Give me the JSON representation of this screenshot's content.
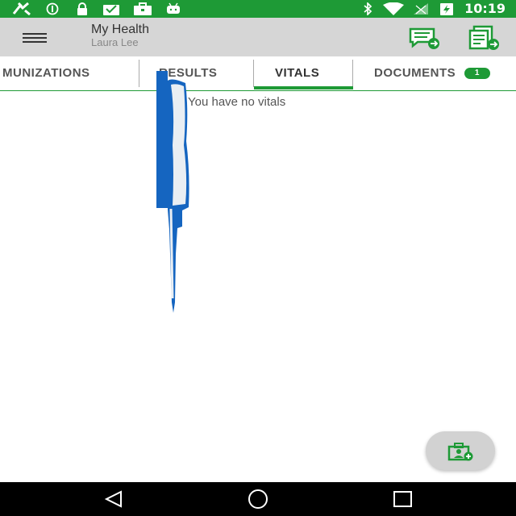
{
  "status_bar": {
    "time": "10:19",
    "left_icons": [
      "fax-icon",
      "info-circle-icon",
      "lock-icon",
      "mail-check-icon",
      "briefcase-icon",
      "android-icon"
    ],
    "right_icons": [
      "bluetooth-icon",
      "wifi-icon",
      "signal-icon",
      "battery-charging-icon"
    ],
    "background_color": "#1e9a36"
  },
  "app_bar": {
    "title": "My Health",
    "subtitle": "Laura Lee",
    "actions": [
      "message-forward-icon",
      "documents-forward-icon"
    ]
  },
  "tabs": [
    {
      "label": "MUNIZATIONS",
      "active": false
    },
    {
      "label": "RESULTS",
      "active": false
    },
    {
      "label": "VITALS",
      "active": true
    },
    {
      "label": "DOCUMENTS",
      "active": false,
      "badge": "1"
    }
  ],
  "content": {
    "empty_message": "You have no vitals"
  },
  "fab": {
    "icon": "add-contact-card-icon"
  },
  "colors": {
    "accent": "#1e9a36",
    "app_bar": "#d6d6d6",
    "overlay_blue": "#1565c0"
  }
}
